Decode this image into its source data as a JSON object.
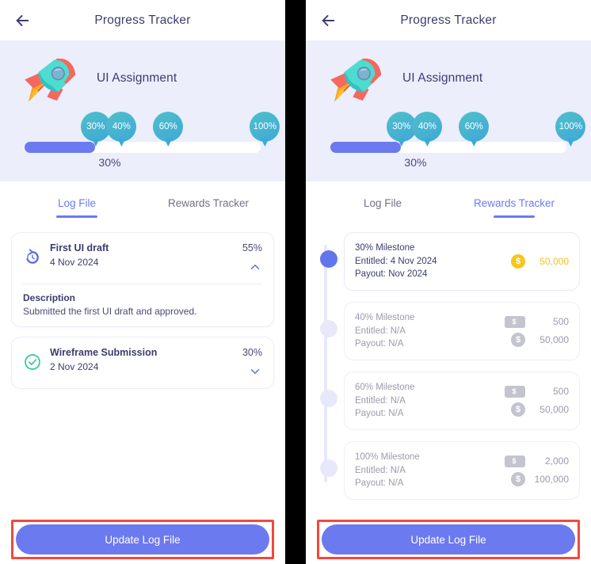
{
  "accent": "#6c7af0",
  "hero_bg": "#eceefc",
  "gold": "#f8c51c",
  "highlight": "#f4483c",
  "appbar": {
    "title": "Progress Tracker",
    "back_icon": "arrow-left-icon"
  },
  "hero": {
    "illustration": "rocket-illustration",
    "title": "UI Assignment",
    "progress_percent": 30,
    "progress_label": "30%",
    "milestones": [
      {
        "label": "30%",
        "value": 30
      },
      {
        "label": "40%",
        "value": 40
      },
      {
        "label": "60%",
        "value": 60
      },
      {
        "label": "100%",
        "value": 100
      }
    ]
  },
  "tabs": [
    {
      "label": "Log File",
      "id": "log-file"
    },
    {
      "label": "Rewards Tracker",
      "id": "rewards-tracker"
    }
  ],
  "left_panel": {
    "active_tab": "Log File",
    "log_entries": [
      {
        "icon": "history-clock-icon",
        "title": "First UI draft",
        "date": "4 Nov 2024",
        "percent": "55%",
        "expanded": true,
        "chevron": "chevron-up-icon",
        "description_label": "Description",
        "description": "Submitted the first UI draft and approved."
      },
      {
        "icon": "check-circle-icon",
        "title": "Wireframe Submission",
        "date": "2 Nov 2024",
        "percent": "30%",
        "expanded": false,
        "chevron": "chevron-down-icon"
      }
    ],
    "footer_button": "Update Log File"
  },
  "right_panel": {
    "active_tab": "Rewards Tracker",
    "rewards": [
      {
        "title": "30% Milestone",
        "entitled": "Entitled: 4 Nov 2024",
        "payout": "Payout: Nov 2024",
        "completed": true,
        "amounts": [
          {
            "icon": "gold-coin-icon",
            "type": "coin",
            "value": "50,000",
            "gold": true
          }
        ]
      },
      {
        "title": "40% Milestone",
        "entitled": "Entitled: N/A",
        "payout": "Payout: N/A",
        "completed": false,
        "amounts": [
          {
            "icon": "banknote-icon",
            "type": "note",
            "value": "500",
            "gold": false
          },
          {
            "icon": "coin-icon",
            "type": "coin",
            "value": "50,000",
            "gold": false
          }
        ]
      },
      {
        "title": "60% Milestone",
        "entitled": "Entitled: N/A",
        "payout": "Payout: N/A",
        "completed": false,
        "amounts": [
          {
            "icon": "banknote-icon",
            "type": "note",
            "value": "500",
            "gold": false
          },
          {
            "icon": "coin-icon",
            "type": "coin",
            "value": "50,000",
            "gold": false
          }
        ]
      },
      {
        "title": "100% Milestone",
        "entitled": "Entitled: N/A",
        "payout": "Payout: N/A",
        "completed": false,
        "amounts": [
          {
            "icon": "banknote-icon",
            "type": "note",
            "value": "2,000",
            "gold": false
          },
          {
            "icon": "coin-icon",
            "type": "coin",
            "value": "100,000",
            "gold": false
          }
        ]
      }
    ],
    "footer_button": "Update Log File"
  }
}
